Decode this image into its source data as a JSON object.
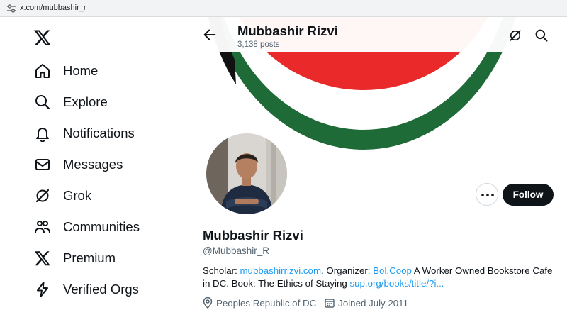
{
  "browser": {
    "url": "x.com/mubbashir_r",
    "site_settings_icon": "tune-icon"
  },
  "sidebar": {
    "logo_icon": "x-logo-icon",
    "items": [
      {
        "label": "Home",
        "icon": "home-icon"
      },
      {
        "label": "Explore",
        "icon": "search-icon"
      },
      {
        "label": "Notifications",
        "icon": "bell-icon"
      },
      {
        "label": "Messages",
        "icon": "envelope-icon"
      },
      {
        "label": "Grok",
        "icon": "grok-icon"
      },
      {
        "label": "Communities",
        "icon": "people-icon"
      },
      {
        "label": "Premium",
        "icon": "x-logo-icon"
      },
      {
        "label": "Verified Orgs",
        "icon": "lightning-icon"
      }
    ]
  },
  "header": {
    "name": "Mubbashir Rizvi",
    "posts": "3,138 posts",
    "back_icon": "arrow-left-icon",
    "grok_icon": "grok-icon",
    "search_icon": "search-icon"
  },
  "banner": {
    "description_colors": {
      "red": "#ea2a2a",
      "green": "#1e6b37",
      "black": "#111111"
    }
  },
  "profile": {
    "display_name": "Mubbashir Rizvi",
    "handle": "@Mubbashir_R",
    "follow_label": "Follow",
    "more_icon": "more-horizontal-icon",
    "bio": {
      "part1": "Scholar: ",
      "link1": "mubbashirrizvi.com",
      "part2": ". Organizer: ",
      "link2": "Bol.Coop",
      "part3": " A Worker Owned Bookstore Cafe in DC. Book: The Ethics of Staying ",
      "link3": "sup.org/books/title/?i..."
    },
    "location": "Peoples Republic of DC",
    "joined": "Joined July 2011",
    "location_icon": "location-pin-icon",
    "calendar_icon": "calendar-icon"
  },
  "colors": {
    "link": "#1d9bf0",
    "text": "#0f1419",
    "muted": "#536471",
    "follow_bg": "#0f1419"
  }
}
